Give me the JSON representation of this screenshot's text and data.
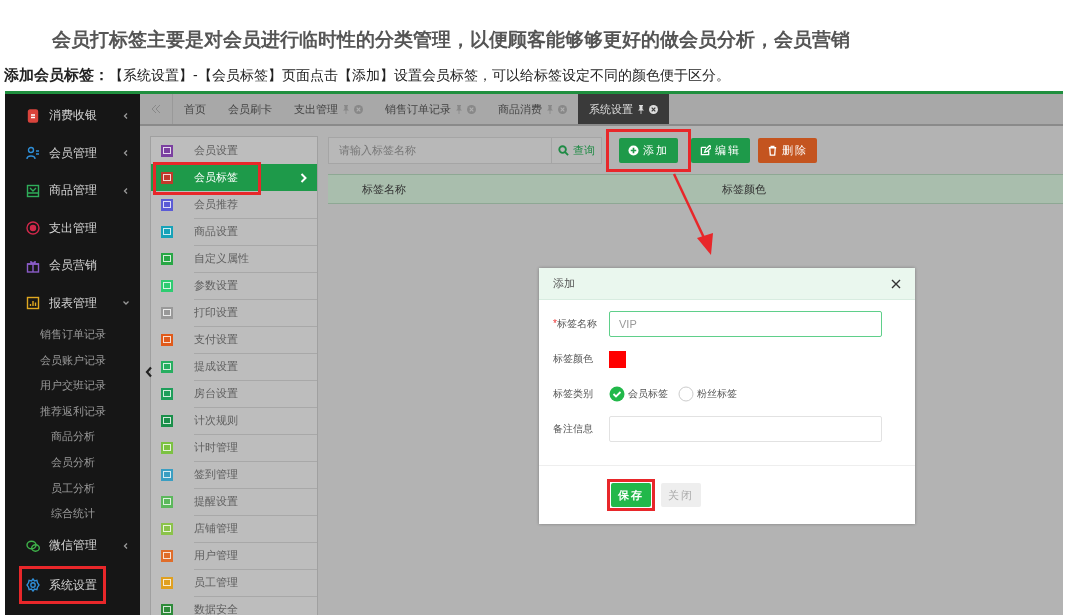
{
  "article": {
    "heading": "会员打标签主要是对会员进行临时性的分类管理，以便顾客能够够更好的做会员分析，会员营销",
    "intro_label": "添加会员标签：",
    "intro_text": "【系统设置】-【会员标签】页面点击【添加】设置会员标签，可以给标签设定不同的颜色便于区分。"
  },
  "app": {
    "sidebar": {
      "items": [
        {
          "label": "消费收银",
          "kind": "menu",
          "expanded": false,
          "highlighted": false
        },
        {
          "label": "会员管理",
          "kind": "menu",
          "expanded": false,
          "highlighted": false
        },
        {
          "label": "商品管理",
          "kind": "menu",
          "expanded": false,
          "highlighted": false
        },
        {
          "label": "支出管理",
          "kind": "link",
          "highlighted": false
        },
        {
          "label": "会员营销",
          "kind": "link",
          "highlighted": false
        },
        {
          "label": "报表管理",
          "kind": "menu",
          "expanded": true,
          "highlighted": false,
          "children": [
            {
              "label": "销售订单记录"
            },
            {
              "label": "会员账户记录"
            },
            {
              "label": "用户交班记录"
            },
            {
              "label": "推荐返利记录"
            },
            {
              "label": "商品分析"
            },
            {
              "label": "会员分析"
            },
            {
              "label": "员工分析"
            },
            {
              "label": "综合统计"
            }
          ]
        },
        {
          "label": "微信管理",
          "kind": "menu",
          "expanded": false,
          "highlighted": false
        },
        {
          "label": "系统设置",
          "kind": "link",
          "highlighted": true
        }
      ]
    },
    "tabs": [
      {
        "label": "首页",
        "closable": false,
        "selected": false
      },
      {
        "label": "会员刷卡",
        "closable": false,
        "selected": false
      },
      {
        "label": "支出管理",
        "closable": true,
        "selected": false
      },
      {
        "label": "销售订单记录",
        "closable": true,
        "selected": false
      },
      {
        "label": "商品消费",
        "closable": true,
        "selected": false
      },
      {
        "label": "系统设置",
        "closable": true,
        "selected": true
      }
    ],
    "settings_menu": [
      {
        "label": "会员设置",
        "color": "#7b3fa0",
        "selected": false,
        "highlighted": false
      },
      {
        "label": "会员标签",
        "color": "#c0392b",
        "selected": true,
        "highlighted": true
      },
      {
        "label": "会员推荐",
        "color": "#5b5bd6",
        "selected": false,
        "highlighted": false
      },
      {
        "label": "商品设置",
        "color": "#17a2b8",
        "selected": false,
        "highlighted": false
      },
      {
        "label": "自定义属性",
        "color": "#28a745",
        "selected": false,
        "highlighted": false
      },
      {
        "label": "参数设置",
        "color": "#2ecc71",
        "selected": false,
        "highlighted": false
      },
      {
        "label": "打印设置",
        "color": "#999999",
        "selected": false,
        "highlighted": false
      },
      {
        "label": "支付设置",
        "color": "#e05a1a",
        "selected": false,
        "highlighted": false
      },
      {
        "label": "提成设置",
        "color": "#27ae60",
        "selected": false,
        "highlighted": false
      },
      {
        "label": "房台设置",
        "color": "#1e9e5a",
        "selected": false,
        "highlighted": false
      },
      {
        "label": "计次规则",
        "color": "#1a8f4a",
        "selected": false,
        "highlighted": false
      },
      {
        "label": "计时管理",
        "color": "#7cc242",
        "selected": false,
        "highlighted": false
      },
      {
        "label": "签到管理",
        "color": "#3a9ec2",
        "selected": false,
        "highlighted": false
      },
      {
        "label": "提醒设置",
        "color": "#5cb85c",
        "selected": false,
        "highlighted": false
      },
      {
        "label": "店铺管理",
        "color": "#8bc34a",
        "selected": false,
        "highlighted": false
      },
      {
        "label": "用户管理",
        "color": "#e06d2a",
        "selected": false,
        "highlighted": false
      },
      {
        "label": "员工管理",
        "color": "#e0a020",
        "selected": false,
        "highlighted": false
      },
      {
        "label": "数据安全",
        "color": "#2e8b3a",
        "selected": false,
        "highlighted": false
      }
    ],
    "toolbar": {
      "search": {
        "placeholder": "请输入标签名称"
      },
      "query_button": "查询",
      "buttons": [
        {
          "label": "添加",
          "kind": "add",
          "highlighted": true
        },
        {
          "label": "编辑",
          "kind": "edit",
          "highlighted": false
        },
        {
          "label": "删除",
          "kind": "delete",
          "highlighted": false
        }
      ]
    },
    "table": {
      "columns": [
        "标签名称",
        "标签颜色"
      ]
    },
    "dialog": {
      "title": "添加",
      "fields": [
        {
          "label": "标签名称",
          "kind": "text",
          "required_mark": "*",
          "value": "VIP"
        },
        {
          "label": "标签颜色",
          "kind": "color",
          "color": "#ff0000"
        },
        {
          "label": "标签类别",
          "kind": "radio",
          "options": [
            {
              "label": "会员标签",
              "selected": true
            },
            {
              "label": "粉丝标签",
              "selected": false
            }
          ]
        },
        {
          "label": "备注信息",
          "kind": "text"
        }
      ],
      "buttons": [
        {
          "label": "保存",
          "disabled": false,
          "highlighted": true
        },
        {
          "label": "关闭",
          "disabled": true,
          "highlighted": false
        }
      ]
    }
  }
}
